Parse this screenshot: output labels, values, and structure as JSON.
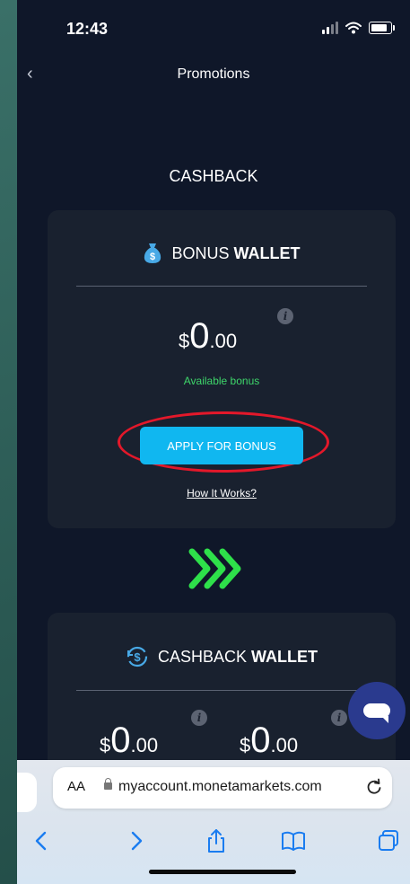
{
  "status_bar": {
    "time": "12:43"
  },
  "nav": {
    "back_icon": "chevron-left-icon",
    "title": "Promotions"
  },
  "section": {
    "title": "CASHBACK"
  },
  "bonus_wallet": {
    "title_light": "BONUS",
    "title_bold": "WALLET",
    "icon": "money-bag-icon",
    "amount": {
      "currency": "$",
      "integer": "0",
      "decimal": ".00"
    },
    "available_label": "Available bonus",
    "apply_button_label": "APPLY FOR BONUS",
    "how_it_works_label": "How It Works?"
  },
  "cashback_wallet": {
    "title_light": "CASHBACK",
    "title_bold": "WALLET",
    "icon": "cashback-cycle-icon",
    "amounts": [
      {
        "currency": "$",
        "integer": "0",
        "decimal": ".00"
      },
      {
        "currency": "$",
        "integer": "0",
        "decimal": ".00"
      }
    ]
  },
  "browser": {
    "aa_label": "AA",
    "url": "myaccount.monetamarkets.com"
  },
  "colors": {
    "background": "#0f1729",
    "card": "#19212f",
    "accent_button": "#10b7f0",
    "available_green": "#3ed66a",
    "chevron_green": "#2ee04a",
    "highlight_red": "#e3182a",
    "chat_button": "#2a3a8e"
  }
}
